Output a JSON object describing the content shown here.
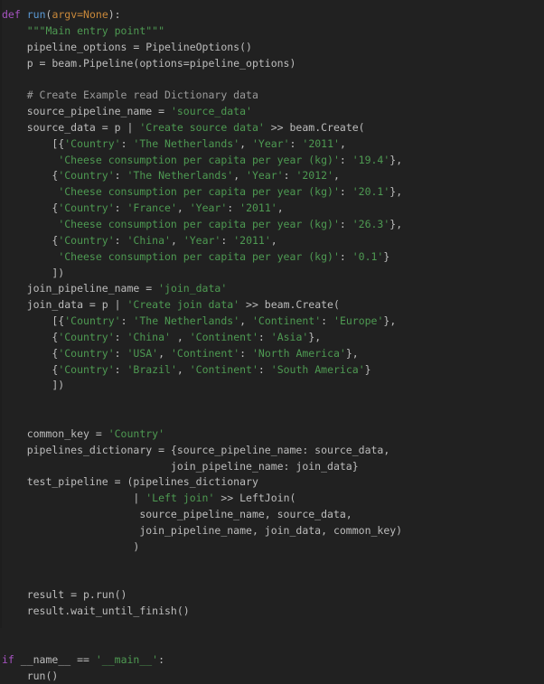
{
  "editor": {
    "language": "Python",
    "background_color": "#212121",
    "colors": {
      "keyword": "#a653c1",
      "function": "#5b9ad5",
      "parameter": "#c9883a",
      "string": "#4e9a52",
      "comment": "#9b9b9b",
      "plain": "#bdbdbd"
    }
  },
  "code": {
    "lines": [
      {
        "n": 1,
        "tokens": [
          {
            "t": "kw",
            "v": "def"
          },
          {
            "t": "pln",
            "v": " "
          },
          {
            "t": "fn",
            "v": "run"
          },
          {
            "t": "pln",
            "v": "("
          },
          {
            "t": "par",
            "v": "argv=None"
          },
          {
            "t": "pln",
            "v": "):"
          }
        ]
      },
      {
        "n": 2,
        "tokens": [
          {
            "t": "pln",
            "v": "    "
          },
          {
            "t": "doc",
            "v": "\"\"\"Main entry point\"\"\""
          }
        ]
      },
      {
        "n": 3,
        "tokens": [
          {
            "t": "pln",
            "v": "    pipeline_options = PipelineOptions()"
          }
        ]
      },
      {
        "n": 4,
        "tokens": [
          {
            "t": "pln",
            "v": "    p = beam.Pipeline(options=pipeline_options)"
          }
        ]
      },
      {
        "n": 5,
        "tokens": [
          {
            "t": "pln",
            "v": ""
          }
        ]
      },
      {
        "n": 6,
        "tokens": [
          {
            "t": "pln",
            "v": "    "
          },
          {
            "t": "com",
            "v": "# Create Example read Dictionary data"
          }
        ]
      },
      {
        "n": 7,
        "tokens": [
          {
            "t": "pln",
            "v": "    source_pipeline_name = "
          },
          {
            "t": "str",
            "v": "'source_data'"
          }
        ]
      },
      {
        "n": 8,
        "tokens": [
          {
            "t": "pln",
            "v": "    source_data = p | "
          },
          {
            "t": "str",
            "v": "'Create source data'"
          },
          {
            "t": "pln",
            "v": " >> beam.Create("
          }
        ]
      },
      {
        "n": 9,
        "tokens": [
          {
            "t": "pln",
            "v": "        [{"
          },
          {
            "t": "str",
            "v": "'Country'"
          },
          {
            "t": "pln",
            "v": ": "
          },
          {
            "t": "str",
            "v": "'The Netherlands'"
          },
          {
            "t": "pln",
            "v": ", "
          },
          {
            "t": "str",
            "v": "'Year'"
          },
          {
            "t": "pln",
            "v": ": "
          },
          {
            "t": "str",
            "v": "'2011'"
          },
          {
            "t": "pln",
            "v": ","
          }
        ]
      },
      {
        "n": 10,
        "tokens": [
          {
            "t": "pln",
            "v": "         "
          },
          {
            "t": "str",
            "v": "'Cheese consumption per capita per year (kg)'"
          },
          {
            "t": "pln",
            "v": ": "
          },
          {
            "t": "str",
            "v": "'19.4'"
          },
          {
            "t": "pln",
            "v": "},"
          }
        ]
      },
      {
        "n": 11,
        "tokens": [
          {
            "t": "pln",
            "v": "        {"
          },
          {
            "t": "str",
            "v": "'Country'"
          },
          {
            "t": "pln",
            "v": ": "
          },
          {
            "t": "str",
            "v": "'The Netherlands'"
          },
          {
            "t": "pln",
            "v": ", "
          },
          {
            "t": "str",
            "v": "'Year'"
          },
          {
            "t": "pln",
            "v": ": "
          },
          {
            "t": "str",
            "v": "'2012'"
          },
          {
            "t": "pln",
            "v": ","
          }
        ]
      },
      {
        "n": 12,
        "tokens": [
          {
            "t": "pln",
            "v": "         "
          },
          {
            "t": "str",
            "v": "'Cheese consumption per capita per year (kg)'"
          },
          {
            "t": "pln",
            "v": ": "
          },
          {
            "t": "str",
            "v": "'20.1'"
          },
          {
            "t": "pln",
            "v": "},"
          }
        ]
      },
      {
        "n": 13,
        "tokens": [
          {
            "t": "pln",
            "v": "        {"
          },
          {
            "t": "str",
            "v": "'Country'"
          },
          {
            "t": "pln",
            "v": ": "
          },
          {
            "t": "str",
            "v": "'France'"
          },
          {
            "t": "pln",
            "v": ", "
          },
          {
            "t": "str",
            "v": "'Year'"
          },
          {
            "t": "pln",
            "v": ": "
          },
          {
            "t": "str",
            "v": "'2011'"
          },
          {
            "t": "pln",
            "v": ","
          }
        ]
      },
      {
        "n": 14,
        "tokens": [
          {
            "t": "pln",
            "v": "         "
          },
          {
            "t": "str",
            "v": "'Cheese consumption per capita per year (kg)'"
          },
          {
            "t": "pln",
            "v": ": "
          },
          {
            "t": "str",
            "v": "'26.3'"
          },
          {
            "t": "pln",
            "v": "},"
          }
        ]
      },
      {
        "n": 15,
        "tokens": [
          {
            "t": "pln",
            "v": "        {"
          },
          {
            "t": "str",
            "v": "'Country'"
          },
          {
            "t": "pln",
            "v": ": "
          },
          {
            "t": "str",
            "v": "'China'"
          },
          {
            "t": "pln",
            "v": ", "
          },
          {
            "t": "str",
            "v": "'Year'"
          },
          {
            "t": "pln",
            "v": ": "
          },
          {
            "t": "str",
            "v": "'2011'"
          },
          {
            "t": "pln",
            "v": ","
          }
        ]
      },
      {
        "n": 16,
        "tokens": [
          {
            "t": "pln",
            "v": "         "
          },
          {
            "t": "str",
            "v": "'Cheese consumption per capita per year (kg)'"
          },
          {
            "t": "pln",
            "v": ": "
          },
          {
            "t": "str",
            "v": "'0.1'"
          },
          {
            "t": "pln",
            "v": "}"
          }
        ]
      },
      {
        "n": 17,
        "tokens": [
          {
            "t": "pln",
            "v": "        ])"
          }
        ]
      },
      {
        "n": 18,
        "tokens": [
          {
            "t": "pln",
            "v": "    join_pipeline_name = "
          },
          {
            "t": "str",
            "v": "'join_data'"
          }
        ]
      },
      {
        "n": 19,
        "tokens": [
          {
            "t": "pln",
            "v": "    join_data = p | "
          },
          {
            "t": "str",
            "v": "'Create join data'"
          },
          {
            "t": "pln",
            "v": " >> beam.Create("
          }
        ]
      },
      {
        "n": 20,
        "tokens": [
          {
            "t": "pln",
            "v": "        [{"
          },
          {
            "t": "str",
            "v": "'Country'"
          },
          {
            "t": "pln",
            "v": ": "
          },
          {
            "t": "str",
            "v": "'The Netherlands'"
          },
          {
            "t": "pln",
            "v": ", "
          },
          {
            "t": "str",
            "v": "'Continent'"
          },
          {
            "t": "pln",
            "v": ": "
          },
          {
            "t": "str",
            "v": "'Europe'"
          },
          {
            "t": "pln",
            "v": "},"
          }
        ]
      },
      {
        "n": 21,
        "tokens": [
          {
            "t": "pln",
            "v": "        {"
          },
          {
            "t": "str",
            "v": "'Country'"
          },
          {
            "t": "pln",
            "v": ": "
          },
          {
            "t": "str",
            "v": "'China'"
          },
          {
            "t": "pln",
            "v": " , "
          },
          {
            "t": "str",
            "v": "'Continent'"
          },
          {
            "t": "pln",
            "v": ": "
          },
          {
            "t": "str",
            "v": "'Asia'"
          },
          {
            "t": "pln",
            "v": "},"
          }
        ]
      },
      {
        "n": 22,
        "tokens": [
          {
            "t": "pln",
            "v": "        {"
          },
          {
            "t": "str",
            "v": "'Country'"
          },
          {
            "t": "pln",
            "v": ": "
          },
          {
            "t": "str",
            "v": "'USA'"
          },
          {
            "t": "pln",
            "v": ", "
          },
          {
            "t": "str",
            "v": "'Continent'"
          },
          {
            "t": "pln",
            "v": ": "
          },
          {
            "t": "str",
            "v": "'North America'"
          },
          {
            "t": "pln",
            "v": "},"
          }
        ]
      },
      {
        "n": 23,
        "tokens": [
          {
            "t": "pln",
            "v": "        {"
          },
          {
            "t": "str",
            "v": "'Country'"
          },
          {
            "t": "pln",
            "v": ": "
          },
          {
            "t": "str",
            "v": "'Brazil'"
          },
          {
            "t": "pln",
            "v": ", "
          },
          {
            "t": "str",
            "v": "'Continent'"
          },
          {
            "t": "pln",
            "v": ": "
          },
          {
            "t": "str",
            "v": "'South America'"
          },
          {
            "t": "pln",
            "v": "}"
          }
        ]
      },
      {
        "n": 24,
        "tokens": [
          {
            "t": "pln",
            "v": "        ])"
          }
        ]
      },
      {
        "n": 25,
        "tokens": [
          {
            "t": "pln",
            "v": ""
          }
        ]
      },
      {
        "n": 26,
        "tokens": [
          {
            "t": "pln",
            "v": ""
          }
        ]
      },
      {
        "n": 27,
        "tokens": [
          {
            "t": "pln",
            "v": "    common_key = "
          },
          {
            "t": "str",
            "v": "'Country'"
          }
        ]
      },
      {
        "n": 28,
        "tokens": [
          {
            "t": "pln",
            "v": "    pipelines_dictionary = {source_pipeline_name: source_data,"
          }
        ]
      },
      {
        "n": 29,
        "tokens": [
          {
            "t": "pln",
            "v": "                           join_pipeline_name: join_data}"
          }
        ]
      },
      {
        "n": 30,
        "tokens": [
          {
            "t": "pln",
            "v": "    test_pipeline = (pipelines_dictionary"
          }
        ]
      },
      {
        "n": 31,
        "tokens": [
          {
            "t": "pln",
            "v": "                     | "
          },
          {
            "t": "str",
            "v": "'Left join'"
          },
          {
            "t": "pln",
            "v": " >> LeftJoin("
          }
        ]
      },
      {
        "n": 32,
        "tokens": [
          {
            "t": "pln",
            "v": "                      source_pipeline_name, source_data,"
          }
        ]
      },
      {
        "n": 33,
        "tokens": [
          {
            "t": "pln",
            "v": "                      join_pipeline_name, join_data, common_key)"
          }
        ]
      },
      {
        "n": 34,
        "tokens": [
          {
            "t": "pln",
            "v": "                     )"
          }
        ]
      },
      {
        "n": 35,
        "tokens": [
          {
            "t": "pln",
            "v": ""
          }
        ]
      },
      {
        "n": 36,
        "tokens": [
          {
            "t": "pln",
            "v": ""
          }
        ]
      },
      {
        "n": 37,
        "tokens": [
          {
            "t": "pln",
            "v": "    result = p.run()"
          }
        ]
      },
      {
        "n": 38,
        "tokens": [
          {
            "t": "pln",
            "v": "    result.wait_until_finish()"
          }
        ]
      },
      {
        "n": 39,
        "tokens": [
          {
            "t": "pln",
            "v": ""
          }
        ]
      },
      {
        "n": 40,
        "tokens": [
          {
            "t": "pln",
            "v": ""
          }
        ]
      },
      {
        "n": 41,
        "tokens": [
          {
            "t": "kw",
            "v": "if"
          },
          {
            "t": "pln",
            "v": " __name__ == "
          },
          {
            "t": "str",
            "v": "'__main__'"
          },
          {
            "t": "pln",
            "v": ":"
          }
        ]
      },
      {
        "n": 42,
        "tokens": [
          {
            "t": "pln",
            "v": "    run()"
          }
        ]
      }
    ]
  }
}
